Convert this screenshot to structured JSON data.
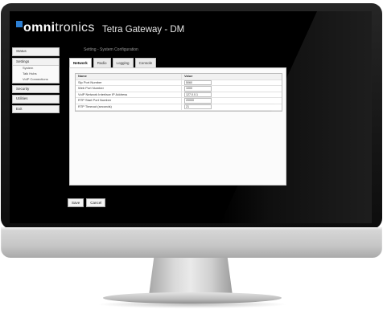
{
  "brand": {
    "omni": "omni",
    "tronics": "tronics"
  },
  "app_title": "Tetra Gateway - DM",
  "sidebar": {
    "items": [
      {
        "label": "Status"
      },
      {
        "label": "Settings",
        "children": [
          {
            "label": "System"
          },
          {
            "label": "Talk Hubs"
          },
          {
            "label": "VoIP Connections"
          }
        ]
      },
      {
        "label": "Security"
      },
      {
        "label": "Utilities"
      },
      {
        "label": "Exit"
      }
    ]
  },
  "breadcrumb": "Setting - System Configuration",
  "tabs": [
    {
      "label": "Network",
      "active": true
    },
    {
      "label": "Radio"
    },
    {
      "label": "Logging"
    },
    {
      "label": "Console"
    }
  ],
  "table": {
    "headers": [
      "Name",
      "Value"
    ],
    "rows": [
      {
        "name": "Sip Port Number",
        "value": "5060"
      },
      {
        "name": "Web Port Number",
        "value": "1000"
      },
      {
        "name": "VoIP Network Interface IP Address",
        "value": "127.0.0.1"
      },
      {
        "name": "RTP Start Port Number",
        "value": "20000"
      },
      {
        "name": "RTP Timeout (seconds)",
        "value": "21"
      }
    ]
  },
  "actions": {
    "save": "Save",
    "cancel": "Cancel"
  },
  "colors": {
    "brand_accent": "#2c7fd4",
    "screen_bg": "#000000",
    "panel_bg": "#fbfbfb"
  }
}
